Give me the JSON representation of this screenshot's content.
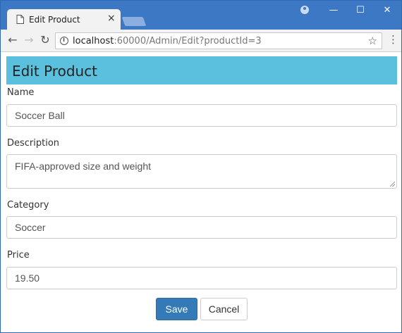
{
  "browser": {
    "tab_title": "Edit Product",
    "tab_close": "×",
    "url_host": "localhost",
    "url_path": ":60000/Admin/Edit?productId=3",
    "back_icon": "←",
    "forward_icon": "→",
    "reload_icon": "↻",
    "star_icon": "☆",
    "menu_icon": "⋮",
    "minimize_icon": "—",
    "maximize_icon": "☐",
    "close_icon": "✕"
  },
  "page": {
    "title": "Edit Product",
    "header_color": "#5bc0de"
  },
  "form": {
    "name_label": "Name",
    "name_value": "Soccer Ball",
    "description_label": "Description",
    "description_value": "FIFA-approved size and weight",
    "category_label": "Category",
    "category_value": "Soccer",
    "price_label": "Price",
    "price_value": "19.50",
    "save_label": "Save",
    "cancel_label": "Cancel"
  }
}
